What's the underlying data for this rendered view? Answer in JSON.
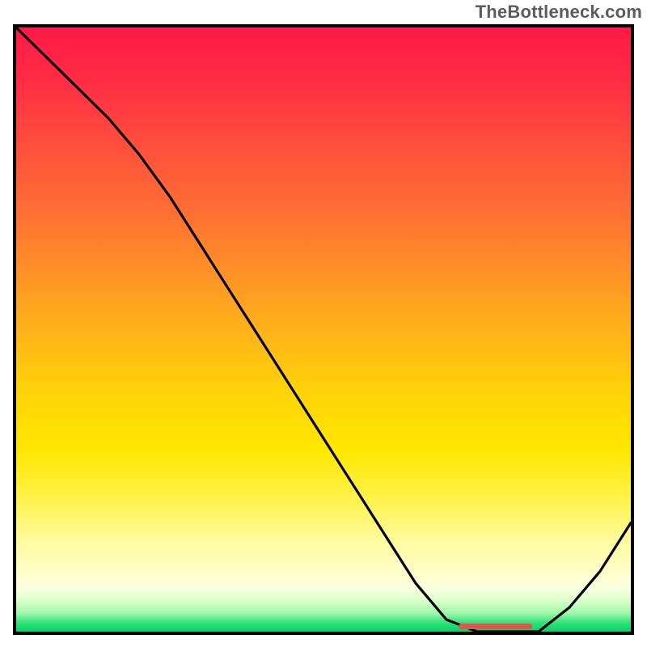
{
  "watermark": "TheBottleneck.com",
  "colors": {
    "frame_border": "#000000",
    "curve": "#000000",
    "marker": "#e0554d",
    "gradient_top": "#ff1a47",
    "gradient_bottom": "#00d46a"
  },
  "chart_data": {
    "type": "line",
    "title": "",
    "xlabel": "",
    "ylabel": "",
    "xlim": [
      0,
      100
    ],
    "ylim": [
      0,
      100
    ],
    "x": [
      0,
      5,
      10,
      15,
      20,
      25,
      30,
      35,
      40,
      45,
      50,
      55,
      60,
      65,
      70,
      75,
      80,
      85,
      90,
      95,
      100
    ],
    "values": [
      100,
      95,
      90,
      85,
      79,
      72,
      64,
      56,
      48,
      40,
      32,
      24,
      16,
      8,
      2,
      0,
      0,
      0,
      4,
      10,
      18
    ],
    "marker_range_x": [
      72,
      84
    ],
    "legend": false,
    "grid": false,
    "annotations": []
  }
}
